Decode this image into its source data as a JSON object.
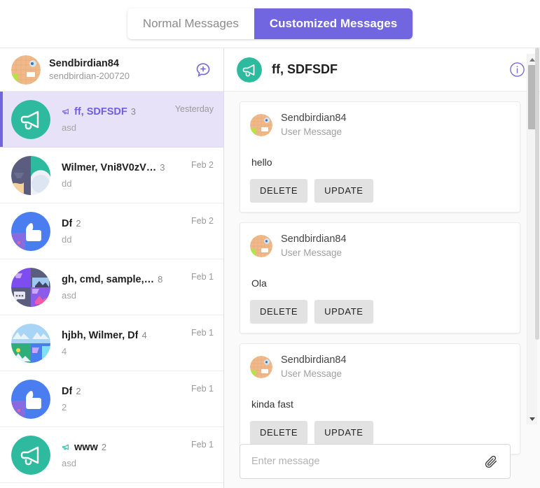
{
  "toggle": {
    "normal_label": "Normal Messages",
    "customized_label": "Customized Messages",
    "active": "Customized Messages"
  },
  "colors": {
    "accent_purple": "#7265e0",
    "avatar_green": "#2eba9f",
    "selected_bg": "#e7e2f7",
    "button_gray": "#e2e2e2"
  },
  "sidebar": {
    "user": {
      "nickname": "Sendbirdian84",
      "user_id": "sendbirdian-200720",
      "avatar_icon": "user-photo-avatar"
    },
    "create_channel_icon": "chat-plus-icon",
    "channels": [
      {
        "title": "ff, SDFSDF",
        "member_count": "3",
        "time": "Yesterday",
        "preview": "asd",
        "avatar_type": "megaphone-green",
        "has_broadcast_icon": true,
        "selected": true
      },
      {
        "title": "Wilmer, Vni8V0zV…",
        "member_count": "3",
        "time": "Feb 2",
        "preview": "dd",
        "avatar_type": "split-two",
        "has_broadcast_icon": false,
        "selected": false
      },
      {
        "title": "Df",
        "member_count": "2",
        "time": "Feb 2",
        "preview": "dd",
        "avatar_type": "thumb-blue",
        "has_broadcast_icon": false,
        "selected": false
      },
      {
        "title": "gh, cmd, sample,…",
        "member_count": "8",
        "time": "Feb 1",
        "preview": "asd",
        "avatar_type": "quad-purple",
        "has_broadcast_icon": false,
        "selected": false
      },
      {
        "title": "hjbh, Wilmer, Df",
        "member_count": "4",
        "time": "Feb 1",
        "preview": "4",
        "avatar_type": "quad-sky",
        "has_broadcast_icon": false,
        "selected": false
      },
      {
        "title": "Df",
        "member_count": "2",
        "time": "Feb 1",
        "preview": "2",
        "avatar_type": "thumb-blue",
        "has_broadcast_icon": false,
        "selected": false
      },
      {
        "title": "www",
        "member_count": "2",
        "time": "Feb 1",
        "preview": "asd",
        "avatar_type": "megaphone-green",
        "has_broadcast_icon": true,
        "selected": false
      }
    ]
  },
  "chat": {
    "header": {
      "title": "ff, SDFSDF",
      "avatar_type": "megaphone-green",
      "info_icon": "info-circle-icon"
    },
    "messages": [
      {
        "sender": "Sendbirdian84",
        "type_label": "User Message",
        "text": "hello",
        "delete_label": "DELETE",
        "update_label": "UPDATE"
      },
      {
        "sender": "Sendbirdian84",
        "type_label": "User Message",
        "text": "Ola",
        "delete_label": "DELETE",
        "update_label": "UPDATE"
      },
      {
        "sender": "Sendbirdian84",
        "type_label": "User Message",
        "text": "kinda fast",
        "delete_label": "DELETE",
        "update_label": "UPDATE"
      }
    ],
    "composer": {
      "placeholder": "Enter message",
      "value": "",
      "attach_icon": "paperclip-icon"
    }
  }
}
